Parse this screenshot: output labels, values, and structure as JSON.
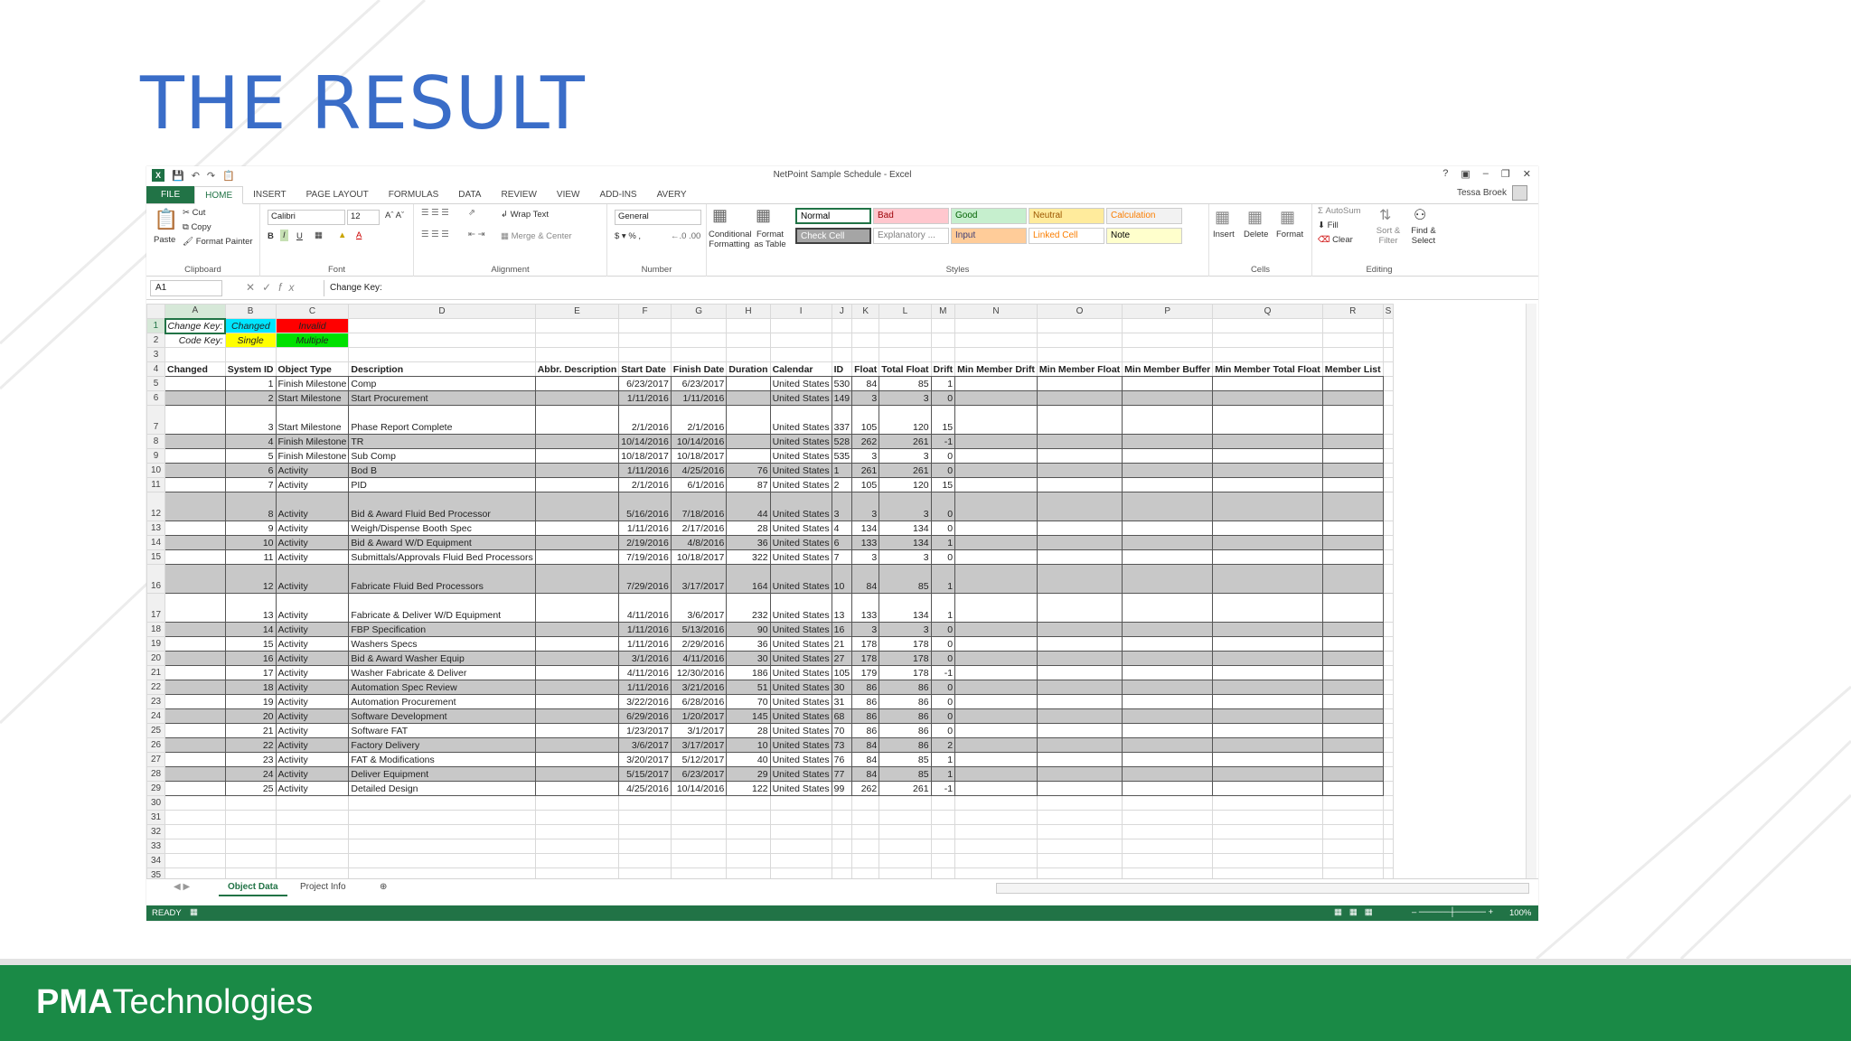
{
  "slide": {
    "title": "THE RESULT",
    "logo_bold": "PMA",
    "logo_rest": "Technologies"
  },
  "excel": {
    "window_title": "NetPoint Sample Schedule - Excel",
    "user": "Tessa Broek",
    "tabs": [
      "FILE",
      "HOME",
      "INSERT",
      "PAGE LAYOUT",
      "FORMULAS",
      "DATA",
      "REVIEW",
      "VIEW",
      "ADD-INS",
      "AVERY"
    ],
    "ribbon": {
      "clipboard": {
        "paste": "Paste",
        "cut": "Cut",
        "copy": "Copy",
        "format_painter": "Format Painter",
        "label": "Clipboard"
      },
      "font": {
        "name": "Calibri",
        "size": "12",
        "label": "Font"
      },
      "alignment": {
        "wrap": "Wrap Text",
        "merge": "Merge & Center",
        "label": "Alignment"
      },
      "number": {
        "format": "General",
        "label": "Number"
      },
      "styles": {
        "conditional": "Conditional Formatting",
        "format_table": "Format as Table",
        "label": "Styles",
        "cells": [
          {
            "name": "Normal",
            "bg": "#ffffff",
            "fg": "#000000"
          },
          {
            "name": "Bad",
            "bg": "#ffc7ce",
            "fg": "#9c0006"
          },
          {
            "name": "Good",
            "bg": "#c6efce",
            "fg": "#006100"
          },
          {
            "name": "Neutral",
            "bg": "#ffeb9c",
            "fg": "#9c5700"
          },
          {
            "name": "Calculation",
            "bg": "#f2f2f2",
            "fg": "#fa7d00"
          },
          {
            "name": "Check Cell",
            "bg": "#a5a5a5",
            "fg": "#ffffff"
          },
          {
            "name": "Explanatory ...",
            "bg": "#ffffff",
            "fg": "#7f7f7f"
          },
          {
            "name": "Input",
            "bg": "#ffcc99",
            "fg": "#3f3f76"
          },
          {
            "name": "Linked Cell",
            "bg": "#ffffff",
            "fg": "#fa7d00"
          },
          {
            "name": "Note",
            "bg": "#ffffcc",
            "fg": "#000000"
          }
        ]
      },
      "cells": {
        "insert": "Insert",
        "delete": "Delete",
        "format": "Format",
        "label": "Cells"
      },
      "editing": {
        "autosum": "AutoSum",
        "fill": "Fill",
        "clear": "Clear",
        "sort": "Sort & Filter",
        "find": "Find & Select",
        "label": "Editing"
      }
    },
    "name_box": "A1",
    "formula": "Change Key:",
    "col_letters": [
      "A",
      "B",
      "C",
      "D",
      "E",
      "F",
      "G",
      "H",
      "I",
      "J",
      "K",
      "L",
      "M",
      "N",
      "O",
      "P",
      "Q",
      "R",
      "S"
    ],
    "key_rows": [
      {
        "label": "Change Key:",
        "b": "Changed",
        "b_bg": "#00e5ff",
        "c": "Invalid",
        "c_bg": "#ff0000"
      },
      {
        "label": "Code Key:",
        "b": "Single",
        "b_bg": "#ffff00",
        "c": "Multiple",
        "c_bg": "#00e000"
      }
    ],
    "headers": [
      "Changed",
      "System ID",
      "Object Type",
      "Description",
      "Abbr. Description",
      "Start Date",
      "Finish Date",
      "Duration",
      "Calendar",
      "ID",
      "Float",
      "Total Float",
      "Drift",
      "Min Member Drift",
      "Min Member Float",
      "Min Member Buffer",
      "Min Member Total Float",
      "Member List"
    ],
    "rows": [
      {
        "r": 5,
        "sid": "1",
        "type": "Finish Milestone",
        "desc": "Comp",
        "start": "6/23/2017",
        "finish": "6/23/2017",
        "dur": "",
        "cal": "United States",
        "id": "530",
        "float": "84",
        "tf": "85",
        "drift": "1",
        "gray": false
      },
      {
        "r": 6,
        "sid": "2",
        "type": "Start Milestone",
        "desc": "Start Procurement",
        "start": "1/11/2016",
        "finish": "1/11/2016",
        "dur": "",
        "cal": "United States",
        "id": "149",
        "float": "3",
        "tf": "3",
        "drift": "0",
        "gray": true
      },
      {
        "r": 7,
        "sid": "3",
        "type": "Start Milestone",
        "desc": "Phase Report Complete",
        "start": "2/1/2016",
        "finish": "2/1/2016",
        "dur": "",
        "cal": "United States",
        "id": "337",
        "float": "105",
        "tf": "120",
        "drift": "15",
        "gray": false,
        "tall": true
      },
      {
        "r": 8,
        "sid": "4",
        "type": "Finish Milestone",
        "desc": "TR",
        "start": "10/14/2016",
        "finish": "10/14/2016",
        "dur": "",
        "cal": "United States",
        "id": "528",
        "float": "262",
        "tf": "261",
        "drift": "-1",
        "gray": true
      },
      {
        "r": 9,
        "sid": "5",
        "type": "Finish Milestone",
        "desc": "Sub Comp",
        "start": "10/18/2017",
        "finish": "10/18/2017",
        "dur": "",
        "cal": "United States",
        "id": "535",
        "float": "3",
        "tf": "3",
        "drift": "0",
        "gray": false
      },
      {
        "r": 10,
        "sid": "6",
        "type": "Activity",
        "desc": "Bod B",
        "start": "1/11/2016",
        "finish": "4/25/2016",
        "dur": "76",
        "cal": "United States",
        "id": "1",
        "float": "261",
        "tf": "261",
        "drift": "0",
        "gray": true
      },
      {
        "r": 11,
        "sid": "7",
        "type": "Activity",
        "desc": "PID",
        "start": "2/1/2016",
        "finish": "6/1/2016",
        "dur": "87",
        "cal": "United States",
        "id": "2",
        "float": "105",
        "tf": "120",
        "drift": "15",
        "gray": false
      },
      {
        "r": 12,
        "sid": "8",
        "type": "Activity",
        "desc": "Bid & Award Fluid Bed Processor",
        "start": "5/16/2016",
        "finish": "7/18/2016",
        "dur": "44",
        "cal": "United States",
        "id": "3",
        "float": "3",
        "tf": "3",
        "drift": "0",
        "gray": true,
        "tall": true
      },
      {
        "r": 13,
        "sid": "9",
        "type": "Activity",
        "desc": "Weigh/Dispense Booth Spec",
        "start": "1/11/2016",
        "finish": "2/17/2016",
        "dur": "28",
        "cal": "United States",
        "id": "4",
        "float": "134",
        "tf": "134",
        "drift": "0",
        "gray": false
      },
      {
        "r": 14,
        "sid": "10",
        "type": "Activity",
        "desc": "Bid & Award  W/D Equipment",
        "start": "2/19/2016",
        "finish": "4/8/2016",
        "dur": "36",
        "cal": "United States",
        "id": "6",
        "float": "133",
        "tf": "134",
        "drift": "1",
        "gray": true
      },
      {
        "r": 15,
        "sid": "11",
        "type": "Activity",
        "desc": "Submittals/Approvals Fluid Bed Processors",
        "start": "7/19/2016",
        "finish": "10/18/2017",
        "dur": "322",
        "cal": "United States",
        "id": "7",
        "float": "3",
        "tf": "3",
        "drift": "0",
        "gray": false
      },
      {
        "r": 16,
        "sid": "12",
        "type": "Activity",
        "desc": "Fabricate  Fluid Bed Processors",
        "start": "7/29/2016",
        "finish": "3/17/2017",
        "dur": "164",
        "cal": "United States",
        "id": "10",
        "float": "84",
        "tf": "85",
        "drift": "1",
        "gray": true,
        "tall": true
      },
      {
        "r": 17,
        "sid": "13",
        "type": "Activity",
        "desc": "Fabricate & Deliver  W/D Equipment",
        "start": "4/11/2016",
        "finish": "3/6/2017",
        "dur": "232",
        "cal": "United States",
        "id": "13",
        "float": "133",
        "tf": "134",
        "drift": "1",
        "gray": false,
        "tall": true
      },
      {
        "r": 18,
        "sid": "14",
        "type": "Activity",
        "desc": "FBP Specification",
        "start": "1/11/2016",
        "finish": "5/13/2016",
        "dur": "90",
        "cal": "United States",
        "id": "16",
        "float": "3",
        "tf": "3",
        "drift": "0",
        "gray": true
      },
      {
        "r": 19,
        "sid": "15",
        "type": "Activity",
        "desc": "Washers Specs",
        "start": "1/11/2016",
        "finish": "2/29/2016",
        "dur": "36",
        "cal": "United States",
        "id": "21",
        "float": "178",
        "tf": "178",
        "drift": "0",
        "gray": false
      },
      {
        "r": 20,
        "sid": "16",
        "type": "Activity",
        "desc": "Bid & Award  Washer Equip",
        "start": "3/1/2016",
        "finish": "4/11/2016",
        "dur": "30",
        "cal": "United States",
        "id": "27",
        "float": "178",
        "tf": "178",
        "drift": "0",
        "gray": true
      },
      {
        "r": 21,
        "sid": "17",
        "type": "Activity",
        "desc": "Washer Fabricate & Deliver",
        "start": "4/11/2016",
        "finish": "12/30/2016",
        "dur": "186",
        "cal": "United States",
        "id": "105",
        "float": "179",
        "tf": "178",
        "drift": "-1",
        "gray": false
      },
      {
        "r": 22,
        "sid": "18",
        "type": "Activity",
        "desc": "Automation Spec Review",
        "start": "1/11/2016",
        "finish": "3/21/2016",
        "dur": "51",
        "cal": "United States",
        "id": "30",
        "float": "86",
        "tf": "86",
        "drift": "0",
        "gray": true
      },
      {
        "r": 23,
        "sid": "19",
        "type": "Activity",
        "desc": "Automation Procurement",
        "start": "3/22/2016",
        "finish": "6/28/2016",
        "dur": "70",
        "cal": "United States",
        "id": "31",
        "float": "86",
        "tf": "86",
        "drift": "0",
        "gray": false
      },
      {
        "r": 24,
        "sid": "20",
        "type": "Activity",
        "desc": "Software Development",
        "start": "6/29/2016",
        "finish": "1/20/2017",
        "dur": "145",
        "cal": "United States",
        "id": "68",
        "float": "86",
        "tf": "86",
        "drift": "0",
        "gray": true
      },
      {
        "r": 25,
        "sid": "21",
        "type": "Activity",
        "desc": "Software FAT",
        "start": "1/23/2017",
        "finish": "3/1/2017",
        "dur": "28",
        "cal": "United States",
        "id": "70",
        "float": "86",
        "tf": "86",
        "drift": "0",
        "gray": false
      },
      {
        "r": 26,
        "sid": "22",
        "type": "Activity",
        "desc": "Factory  Delivery",
        "start": "3/6/2017",
        "finish": "3/17/2017",
        "dur": "10",
        "cal": "United States",
        "id": "73",
        "float": "84",
        "tf": "86",
        "drift": "2",
        "gray": true
      },
      {
        "r": 27,
        "sid": "23",
        "type": "Activity",
        "desc": "FAT &  Modifications",
        "start": "3/20/2017",
        "finish": "5/12/2017",
        "dur": "40",
        "cal": "United States",
        "id": "76",
        "float": "84",
        "tf": "85",
        "drift": "1",
        "gray": false
      },
      {
        "r": 28,
        "sid": "24",
        "type": "Activity",
        "desc": "Deliver  Equipment",
        "start": "5/15/2017",
        "finish": "6/23/2017",
        "dur": "29",
        "cal": "United States",
        "id": "77",
        "float": "84",
        "tf": "85",
        "drift": "1",
        "gray": true
      },
      {
        "r": 29,
        "sid": "25",
        "type": "Activity",
        "desc": "Detailed Design",
        "start": "4/25/2016",
        "finish": "10/14/2016",
        "dur": "122",
        "cal": "United States",
        "id": "99",
        "float": "262",
        "tf": "261",
        "drift": "-1",
        "gray": false
      }
    ],
    "empty_rows": [
      30,
      31,
      32,
      33,
      34,
      35
    ],
    "sheets": [
      "Object Data",
      "Project Info"
    ],
    "status": {
      "ready": "READY",
      "zoom": "100%"
    }
  }
}
